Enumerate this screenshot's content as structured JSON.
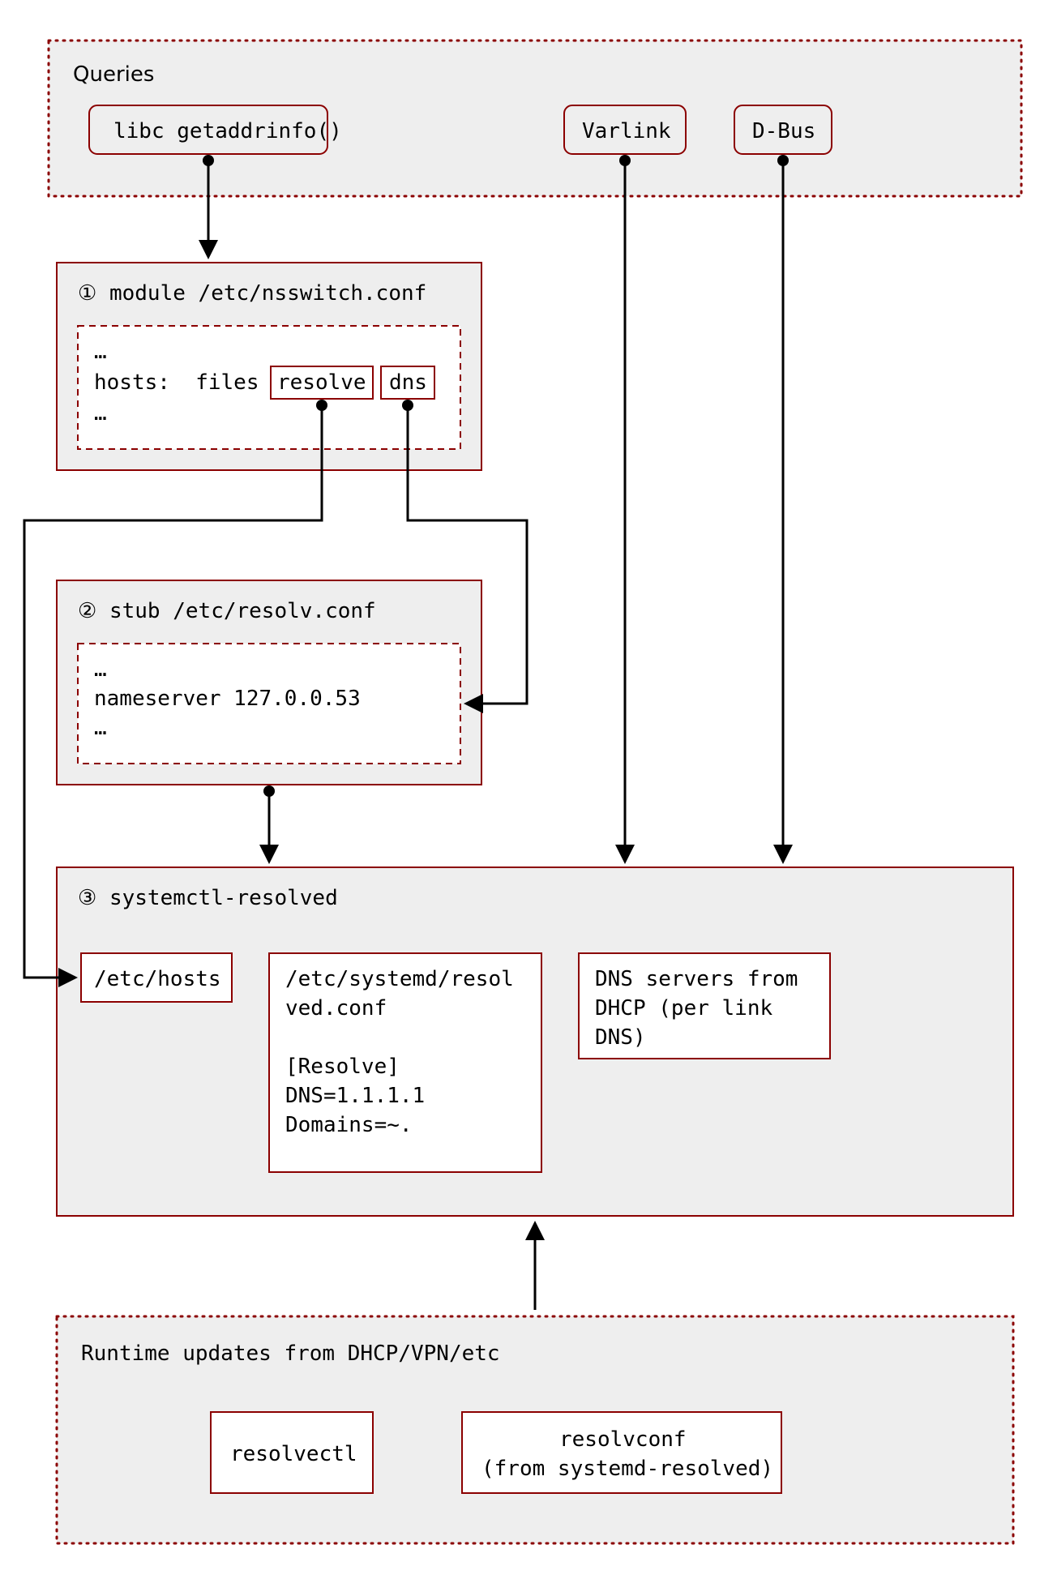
{
  "queries": {
    "title": "Queries",
    "libc": "libc getaddrinfo()",
    "varlink": "Varlink",
    "dbus": "D-Bus"
  },
  "nsswitch": {
    "title": "① module /etc/nsswitch.conf",
    "line1": "…",
    "line2a": "hosts:  files ",
    "resolve": "resolve",
    "dns": "dns",
    "line3": "…"
  },
  "resolvconf": {
    "title": "② stub /etc/resolv.conf",
    "line1": "…",
    "line2": "nameserver 127.0.0.53",
    "line3": "…"
  },
  "resolved": {
    "title": "③ systemctl-resolved",
    "hosts": "/etc/hosts",
    "conf_l1": "/etc/systemd/resol",
    "conf_l2": "ved.conf",
    "conf_l3": "[Resolve]",
    "conf_l4": "DNS=1.1.1.1",
    "conf_l5": "Domains=~.",
    "dhcp_l1": "DNS servers from",
    "dhcp_l2": "DHCP (per link",
    "dhcp_l3": "DNS)"
  },
  "runtime": {
    "title": "Runtime updates from DHCP/VPN/etc",
    "resolvectl": "resolvectl",
    "resolvconf_l1": "resolvconf",
    "resolvconf_l2": "(from systemd-resolved)"
  }
}
